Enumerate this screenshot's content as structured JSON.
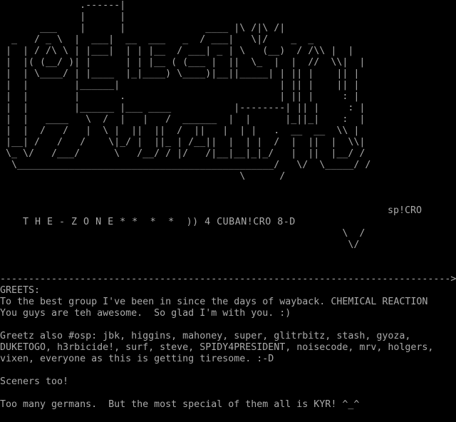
{
  "colors": {
    "background": "#000000",
    "text": "#aaaaaa"
  },
  "logo": {
    "art": "              .------|\n              |      |\n       ___    |      |              ____ |\\ /|\\ /|\n  _   / _ \\  |  ___|  __  ___   _  / ___|   \\|/    _  _\n |  | / /\\ \\ | |___|  | | |__  / ___| _ | \\   (__)  / /\\\\ |  |\n |  |( (__/ )| |      | | |__ ( (___ |  ||  \\_  |  |  //  \\\\|  |\n |  | \\____/ | |____  |_|____) \\____)|__||_____| | || |    || |\n |  |        |______|                            | || |    || |\n |  |        |       .                           | || |     : |\n |  |        |______ |___ ____           |--------| || |     : |\n |  |   ____   \\  /  |   |   /  ______  |  |      |_||_|    :  |\n |  |  /   /   |  \\ |  ||  ||  /  ||   |  | |   .  __  __  \\\\ |\n |__| /   /   /    \\|_/ |  ||_ | /__||  |  | |  /  |  ||  |  \\\\|\n \\_ \\/   /___/      \\   /__/ / |/   /|__|__|_|_/   |  ||  |__/ /\n  \\_____________________________________________/   \\/  \\_____/ /\n                                          \\      /",
    "zone_line": "T H E - Z O N E * *  *  *  )) 4 CUBAN!CRO 8-D",
    "signature": "sp!CRO",
    "arrow_tip": "                                                            \\  /\n                                                             \\/",
    "divider": "------------------------------------------------------------------------------->>"
  },
  "text": {
    "lines": [
      "GREETS:",
      "To the best group I've been in since the days of wayback. CHEMICAL REACTION",
      "You guys are teh awesome.  So glad I'm with you. :)",
      "",
      "Greetz also #osp: jbk, higgins, mahoney, super, glitrbitz, stash, gyoza,",
      "DUKETOGO, h3rbicide!, surf, steve, SPIDY4PRESIDENT, noisecode, mrv, holgers,",
      "vixen, everyone as this is getting tiresome. :-D",
      "",
      "Sceners too!",
      "",
      "Too many germans.  But the most special of them all is KYR! ^_^"
    ]
  }
}
